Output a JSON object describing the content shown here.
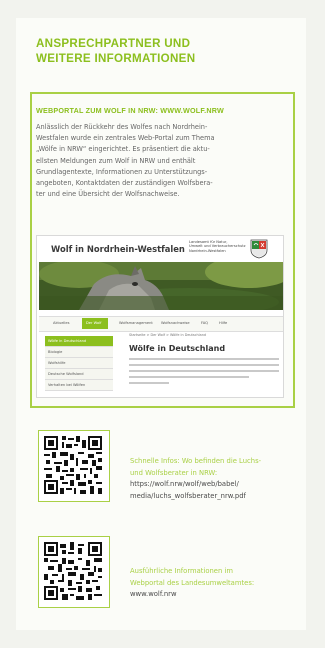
{
  "heading": {
    "line1": "ANSPRECHPARTNER UND",
    "line2": "WEITERE INFORMATIONEN"
  },
  "box": {
    "title": "WEBPORTAL ZUM WOLF IN NRW: WWW.WOLF.NRW",
    "body_lines": [
      "Anlässlich der Rückkehr des Wolfes nach Nordrhein-",
      "Westfalen wurde ein zentrales Web-Portal zum Thema",
      "„Wölfe in NRW“ eingerichtet. Es präsentiert die aktu-",
      "ellsten Meldungen zum Wolf in NRW und enthält",
      "Grundlagentexte, Informationen zu Unterstützungs-",
      "angeboten, Kontaktdaten der zuständigen Wolfsbera-",
      "ter und eine Übersicht der Wolfsnachweise."
    ]
  },
  "screenshot": {
    "site_title": "Wolf in Nordrhein-Westfalen",
    "org_lines": [
      "Landesamt für Natur,",
      "Umwelt und Verbraucherschutz",
      "Nordrhein-Westfalen"
    ],
    "nav": [
      "Aktuelles",
      "Der Wolf",
      "Wolfsmanagement",
      "Wolfsnachweise",
      "FAQ",
      "Hilfe"
    ],
    "sidebar": [
      "Wölfe in Deutschland",
      "Biologie",
      "Wolfshilfe",
      "Deutsche Wolfsland",
      "Verhalten bei Wölfen"
    ],
    "breadcrumb": "Startseite > Der Wolf > Wölfe in Deutschland",
    "page_heading": "Wölfe in Deutschland"
  },
  "links": [
    {
      "label_lines": [
        "Schnelle Infos: Wo befinden die Luchs-",
        "und Wolfsberater in NRW:"
      ],
      "url_lines": [
        "https://wolf.nrw/wolf/web/babel/",
        "media/luchs_wolfsberater_nrw.pdf"
      ]
    },
    {
      "label_lines": [
        "Ausführliche Informationen im",
        "Webportal des Landesumweltamtes:"
      ],
      "url_lines": [
        "www.wolf.nrw"
      ]
    }
  ],
  "colors": {
    "accent": "#8cbf1e",
    "border": "#a9d045"
  }
}
